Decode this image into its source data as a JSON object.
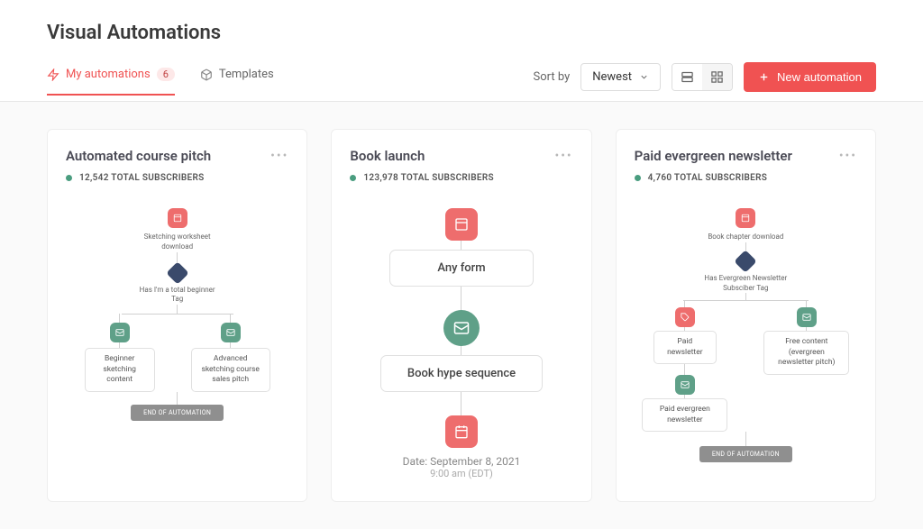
{
  "page": {
    "title": "Visual Automations"
  },
  "tabs": {
    "my": {
      "label": "My automations",
      "count": "6"
    },
    "templates": {
      "label": "Templates"
    }
  },
  "controls": {
    "sort_label": "Sort by",
    "sort_value": "Newest",
    "new_btn": "New automation"
  },
  "cards": [
    {
      "title": "Automated course pitch",
      "subs": "12,542 TOTAL SUBSCRIBERS",
      "n1": "Sketching worksheet download",
      "n2": "Has I'm a total beginner Tag",
      "left": "Beginner sketching content",
      "right": "Advanced sketching course sales pitch",
      "end": "END OF AUTOMATION"
    },
    {
      "title": "Book launch",
      "subs": "123,978 TOTAL SUBSCRIBERS",
      "n1": "Any form",
      "n2": "Book hype sequence",
      "date": "Date: September 8, 2021",
      "time": "9:00 am (EDT)"
    },
    {
      "title": "Paid evergreen newsletter",
      "subs": "4,760 TOTAL SUBSCRIBERS",
      "n1": "Book chapter download",
      "n2": "Has Evergreen Newsletter Subsciber Tag",
      "left": "Paid newsletter",
      "right": "Free content (evergreen newsletter pitch)",
      "n3": "Paid evergreen newsletter",
      "end": "END OF AUTOMATION"
    }
  ]
}
